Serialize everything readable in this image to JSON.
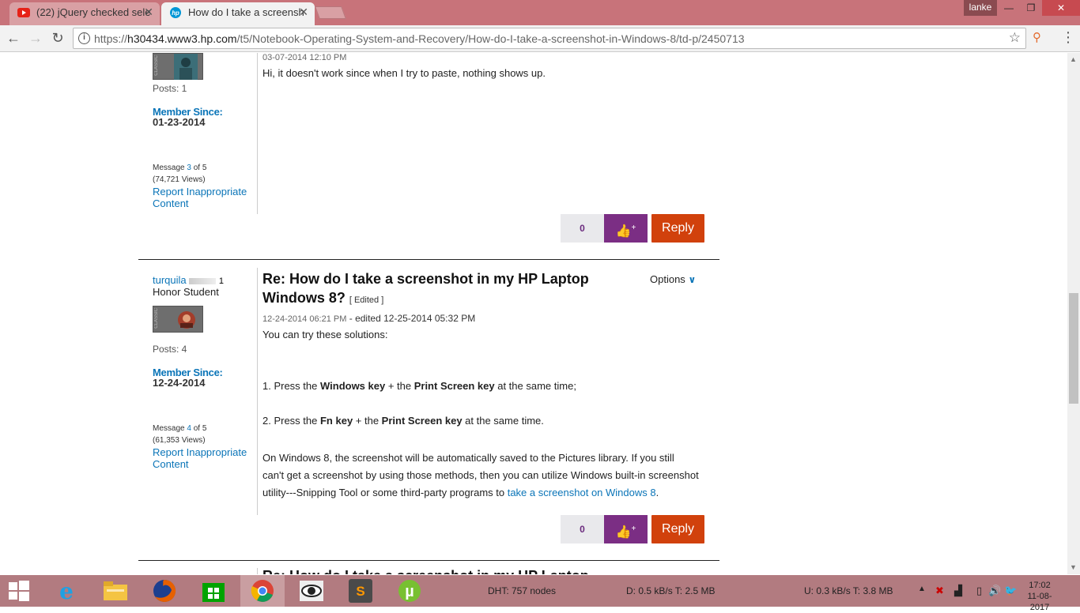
{
  "browser": {
    "tabs": [
      {
        "title": "(22) jQuery checked sele",
        "icon": "youtube-icon",
        "active": false
      },
      {
        "title": "How do I take a screensh",
        "icon": "hp-icon",
        "active": true
      }
    ],
    "user": "lanke",
    "url_prefix": "https://",
    "url_host": "h30434.www3.hp.com",
    "url_path": "/t5/Notebook-Operating-System-and-Recovery/How-do-I-take-a-screenshot-in-Windows-8/td-p/2450713"
  },
  "posts": [
    {
      "posts_count": "Posts: 1",
      "member_since_label": "Member Since:",
      "member_since": "01-23-2014",
      "message_prefix": "Message",
      "message_num": "3",
      "message_of": "of 5",
      "views": "(74,721 Views)",
      "report_line1": "Report Inappropriate",
      "report_line2": "Content",
      "timestamp": "03-07-2014 12:10 PM",
      "body": "Hi, it doesn't work since when I try to paste, nothing shows up.",
      "kudos": "0",
      "reply": "Reply"
    },
    {
      "username": "turquila",
      "rank_num": "1",
      "rank": "Honor Student",
      "posts_count": "Posts: 4",
      "member_since_label": "Member Since:",
      "member_since": "12-24-2014",
      "message_prefix": "Message",
      "message_num": "4",
      "message_of": "of 5",
      "views": "(61,353 Views)",
      "report_line1": "Report Inappropriate",
      "report_line2": "Content",
      "title_line1": "Re: How do I take a screenshot in my HP Laptop",
      "title_line2": "Windows 8?",
      "edited_tag": "[ Edited ]",
      "options": "Options",
      "timestamp": "12-24-2014 06:21 PM",
      "edited_text": " - edited 12-25-2014 05:32 PM",
      "intro": "You can try these solutions:",
      "step1_a": "1. Press the ",
      "step1_b": "Windows key",
      "step1_c": " + the ",
      "step1_d": "Print Screen key",
      "step1_e": " at the same time;",
      "step2_a": "2. Press the ",
      "step2_b": "Fn key",
      "step2_c": " + the ",
      "step2_d": "Print Screen key",
      "step2_e": " at the same time.",
      "para_line1": "On Windows 8, the screenshot will be automatically saved to the Pictures library.  If you still",
      "para_line2": "can't get a screenshot by using those methods, then you can utilize Windows built-in screenshot",
      "para_line3_a": "utility---Snipping Tool or some third-party programs to ",
      "para_line3_link": "take a screenshot on Windows 8",
      "para_line3_b": ".",
      "kudos": "0",
      "reply": "Reply"
    }
  ],
  "next_post_partial": "Re: How do I take a screenshot in my HP Laptop",
  "taskbar": {
    "dht": "DHT: 757 nodes",
    "download": "D: 0.5 kB/s T: 2.5 MB",
    "upload": "U: 0.3 kB/s T: 3.8 MB",
    "time": "17:02",
    "date": "11-08-2017"
  },
  "colors": {
    "accent_blue": "#0b75b8",
    "kudo_purple": "#7b2e84",
    "reply_orange": "#d1410c",
    "taskbar": "#b27b80",
    "titlebar": "#c8737a"
  }
}
